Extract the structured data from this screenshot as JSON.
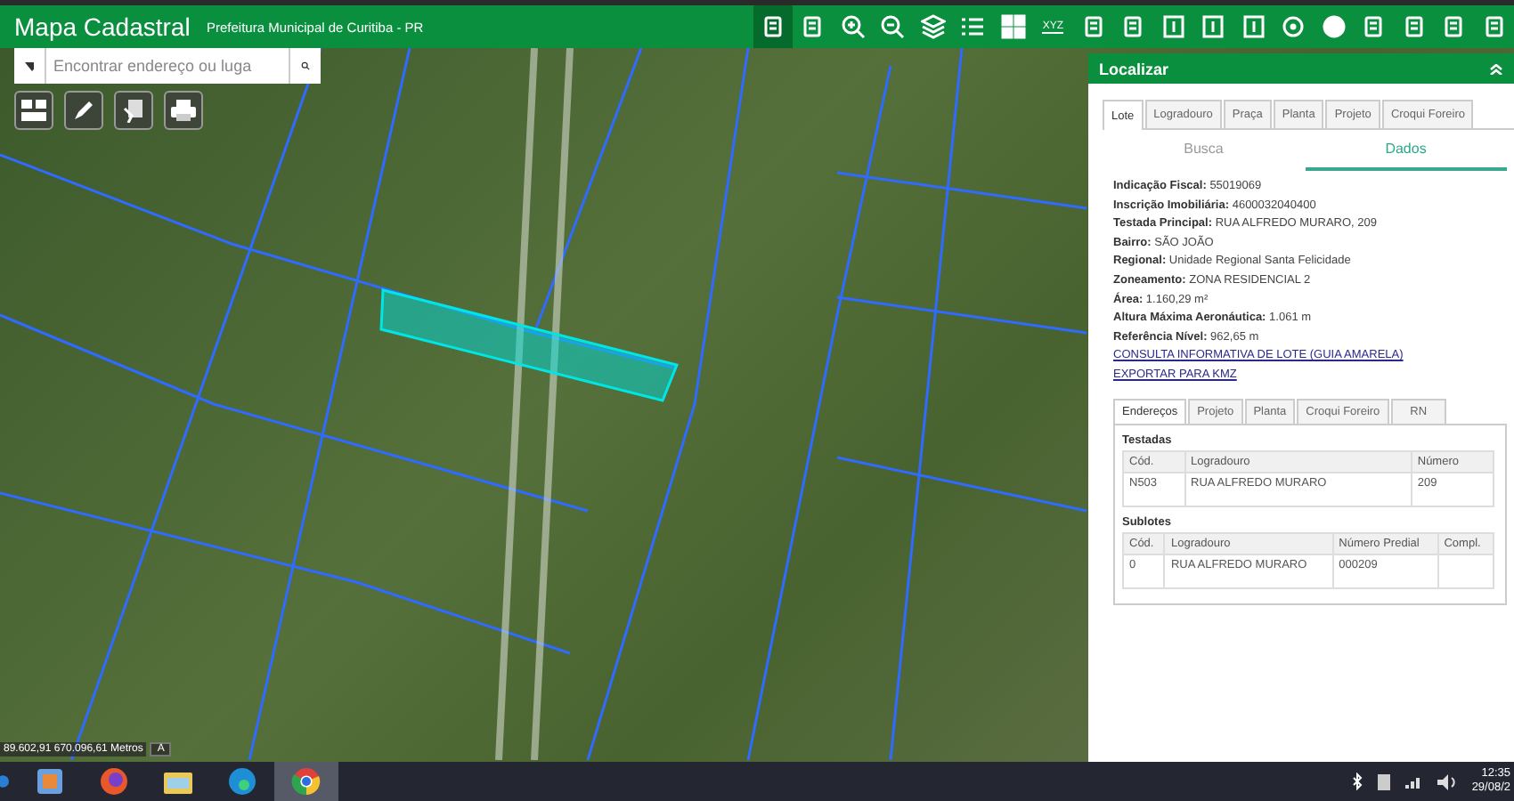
{
  "header": {
    "title": "Mapa Cadastral",
    "subtitle": "Prefeitura Municipal de Curitiba - PR"
  },
  "toolbar": {
    "items": [
      {
        "selected": true
      },
      {
        "selected": false
      },
      {
        "selected": false
      },
      {
        "selected": false
      },
      {
        "selected": false
      },
      {
        "selected": false
      },
      {
        "selected": false
      },
      {
        "selected": false
      },
      {
        "selected": false
      },
      {
        "selected": false
      },
      {
        "selected": false
      },
      {
        "selected": false
      },
      {
        "selected": false
      },
      {
        "selected": false
      },
      {
        "selected": false
      },
      {
        "selected": false
      },
      {
        "selected": false
      },
      {
        "selected": false
      },
      {
        "selected": false
      }
    ],
    "xyz_label": "XYZ"
  },
  "search": {
    "placeholder": "Encontrar endereço ou luga"
  },
  "map": {
    "coordinates": "89.602,91 670.096,61 Metros",
    "units_button": "A"
  },
  "panel": {
    "title": "Localizar",
    "tabs": [
      {
        "label": "Lote",
        "selected": true
      },
      {
        "label": "Logradouro",
        "selected": false
      },
      {
        "label": "Praça",
        "selected": false
      },
      {
        "label": "Planta",
        "selected": false
      },
      {
        "label": "Projeto",
        "selected": false
      },
      {
        "label": "Croqui Foreiro",
        "selected": false
      }
    ],
    "subtabs": [
      {
        "label": "Busca",
        "selected": false
      },
      {
        "label": "Dados",
        "selected": true
      }
    ],
    "fields": [
      {
        "label": "Indicação Fiscal:",
        "value": "55019069"
      },
      {
        "label": "Inscrição Imobiliária:",
        "value": "4600032040400"
      },
      {
        "label": "Testada Principal:",
        "value": "RUA ALFREDO MURARO, 209"
      },
      {
        "label": "Bairro:",
        "value": "SÃO JOÃO"
      },
      {
        "label": "Regional:",
        "value": "Unidade Regional Santa Felicidade"
      },
      {
        "label": "Zoneamento:",
        "value": "ZONA RESIDENCIAL 2"
      },
      {
        "label": "Área:",
        "value": "1.160,29 m²"
      },
      {
        "label": "Altura Máxima Aeronáutica:",
        "value": "1.061 m"
      },
      {
        "label": "Referência Nível:",
        "value": "962,65 m"
      }
    ],
    "links": [
      "CONSULTA INFORMATIVA DE LOTE (GUIA AMARELA)",
      "EXPORTAR PARA KMZ"
    ],
    "detail_tabs": [
      {
        "label": "Endereços",
        "selected": true
      },
      {
        "label": "Projeto",
        "selected": false
      },
      {
        "label": "Planta",
        "selected": false
      },
      {
        "label": "Croqui Foreiro",
        "selected": false
      },
      {
        "label": "RN",
        "selected": false
      }
    ],
    "tables": [
      {
        "title": "Testadas",
        "columns": [
          "Cód.",
          "Logradouro",
          "Número"
        ],
        "rows": [
          [
            "N503",
            "RUA ALFREDO MURARO",
            "209"
          ]
        ]
      },
      {
        "title": "Sublotes",
        "columns": [
          "Cód.",
          "Logradouro",
          "Número Predial",
          "Compl."
        ],
        "rows": [
          [
            "0",
            "RUA ALFREDO MURARO",
            "000209",
            ""
          ]
        ]
      }
    ]
  },
  "taskbar": {
    "apps": [
      {
        "selected": false
      },
      {
        "selected": false
      },
      {
        "selected": false
      },
      {
        "selected": false
      },
      {
        "selected": false
      },
      {
        "selected": true
      }
    ],
    "time": "12:35",
    "date": "29/08/2"
  }
}
